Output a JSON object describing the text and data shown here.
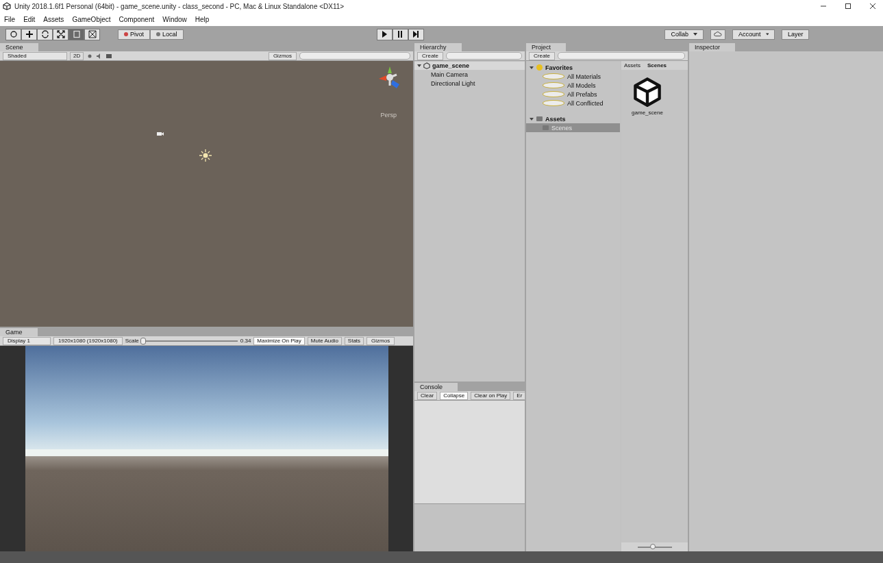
{
  "window": {
    "title": "Unity 2018.1.6f1 Personal (64bit) - game_scene.unity - class_second - PC, Mac & Linux Standalone <DX11>"
  },
  "menu": [
    "File",
    "Edit",
    "Assets",
    "GameObject",
    "Component",
    "Window",
    "Help"
  ],
  "toolbar": {
    "tools": [
      {
        "kind": "hand",
        "selected": false
      },
      {
        "kind": "move",
        "selected": false
      },
      {
        "kind": "rotate",
        "selected": false
      },
      {
        "kind": "scale",
        "selected": false
      },
      {
        "kind": "rect",
        "selected": true
      },
      {
        "kind": "transform",
        "selected": false
      }
    ],
    "pivot": "Pivot",
    "space": "Local",
    "play": [
      {
        "kind": "play",
        "selected": false
      },
      {
        "kind": "pause",
        "selected": false
      },
      {
        "kind": "step",
        "selected": false
      }
    ],
    "collab": "Collab",
    "account": "Account",
    "layers": "Layer"
  },
  "scene": {
    "tab": "Scene",
    "shading": "Shaded",
    "mode_2d": {
      "label": "2D",
      "selected": false
    },
    "gizmos": "Gizmos",
    "projection": "Persp"
  },
  "game": {
    "tab": "Game",
    "display": "Display 1",
    "resolution": "1920x1080 (1920x1080)",
    "scale_label": "Scale",
    "scale": {
      "level": 0
    },
    "scale_value": "0.34",
    "toggles": [
      {
        "label": "Maximize On Play",
        "selected": true
      },
      {
        "label": "Mute Audio",
        "selected": false
      },
      {
        "label": "Stats",
        "selected": false
      }
    ],
    "gizmos": "Gizmos"
  },
  "hierarchy": {
    "tab": "Hierarchy",
    "create": "Create",
    "scene": {
      "name": "game_scene",
      "expanded": true,
      "children": [
        "Main Camera",
        "Directional Light"
      ]
    }
  },
  "console": {
    "tab": "Console",
    "buttons": [
      {
        "label": "Clear",
        "selected": false
      },
      {
        "label": "Collapse",
        "selected": true
      },
      {
        "label": "Clear on Play",
        "selected": false
      },
      {
        "label": "Er",
        "selected": false
      }
    ]
  },
  "project": {
    "tab": "Project",
    "create": "Create",
    "tree": [
      {
        "name": "Favorites",
        "kind": "favorites",
        "expanded": true,
        "selected": false,
        "children": [
          {
            "name": "All Materials",
            "kind": "search",
            "selected": false
          },
          {
            "name": "All Models",
            "kind": "search",
            "selected": false
          },
          {
            "name": "All Prefabs",
            "kind": "search",
            "selected": false
          },
          {
            "name": "All Conflicted",
            "kind": "search",
            "selected": false
          }
        ]
      },
      {
        "name": "Assets",
        "kind": "folder",
        "expanded": true,
        "selected": false,
        "children": [
          {
            "name": "Scenes",
            "kind": "folder",
            "selected": true
          }
        ]
      }
    ],
    "breadcrumb": [
      "Assets",
      "Scenes"
    ],
    "assets": [
      {
        "name": "game_scene",
        "kind": "scene"
      }
    ],
    "zoom": {
      "level": 0.45
    }
  },
  "inspector": {
    "tab": "Inspector"
  }
}
